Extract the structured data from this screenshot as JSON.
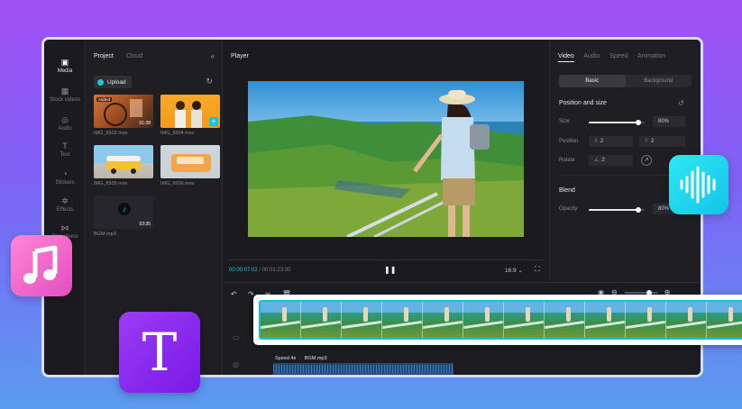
{
  "nav": {
    "items": [
      {
        "label": "Media",
        "icon": "media-icon"
      },
      {
        "label": "Stock videos",
        "icon": "stock-videos-icon"
      },
      {
        "label": "Audio",
        "icon": "audio-icon"
      },
      {
        "label": "Text",
        "icon": "text-icon"
      },
      {
        "label": "Stickers",
        "icon": "stickers-icon"
      },
      {
        "label": "Effects",
        "icon": "effects-icon"
      },
      {
        "label": "Transitions",
        "icon": "transitions-icon"
      }
    ]
  },
  "project": {
    "tabs": [
      "Project",
      "Cloud"
    ],
    "upload_label": "Upload",
    "media": [
      {
        "name": "IMG_6502.mov",
        "duration": "01:38",
        "badge": "Added"
      },
      {
        "name": "IMG_6504.mov",
        "duration": "",
        "badge": ""
      },
      {
        "name": "IMG_6505.mov",
        "duration": "",
        "badge": ""
      },
      {
        "name": "IMG_6506.mov",
        "duration": "",
        "badge": ""
      },
      {
        "name": "BGM.mp3",
        "duration": "03:35",
        "badge": ""
      }
    ]
  },
  "player": {
    "label": "Player",
    "current_time": "00:00:07:02",
    "total_time": "/ 00:01:23:00",
    "ratio": "16:9 ⌄"
  },
  "props": {
    "tabs": [
      "Video",
      "Audio",
      "Speed",
      "Animation"
    ],
    "segments": [
      "Basic",
      "Background"
    ],
    "position_size_title": "Position and size",
    "size_label": "Size",
    "size_value": "80%",
    "size_level": 0.88,
    "position_label": "Position",
    "position_x": "2",
    "position_y": "2",
    "rotate_label": "Rotate",
    "rotate_value": "2",
    "blend_title": "Blend",
    "opacity_label": "Opacity",
    "opacity_value": "80%",
    "opacity_level": 0.88
  },
  "timeline": {
    "audio_speed": "Speed 4x",
    "audio_name": "BGM.mp3"
  },
  "floating": {
    "text_app_glyph": "T"
  },
  "colors": {
    "accent": "#1ac7d6",
    "music_app": "#ee5ec9",
    "text_app": "#8a2cf0",
    "voice_app": "#1ed2ee"
  }
}
